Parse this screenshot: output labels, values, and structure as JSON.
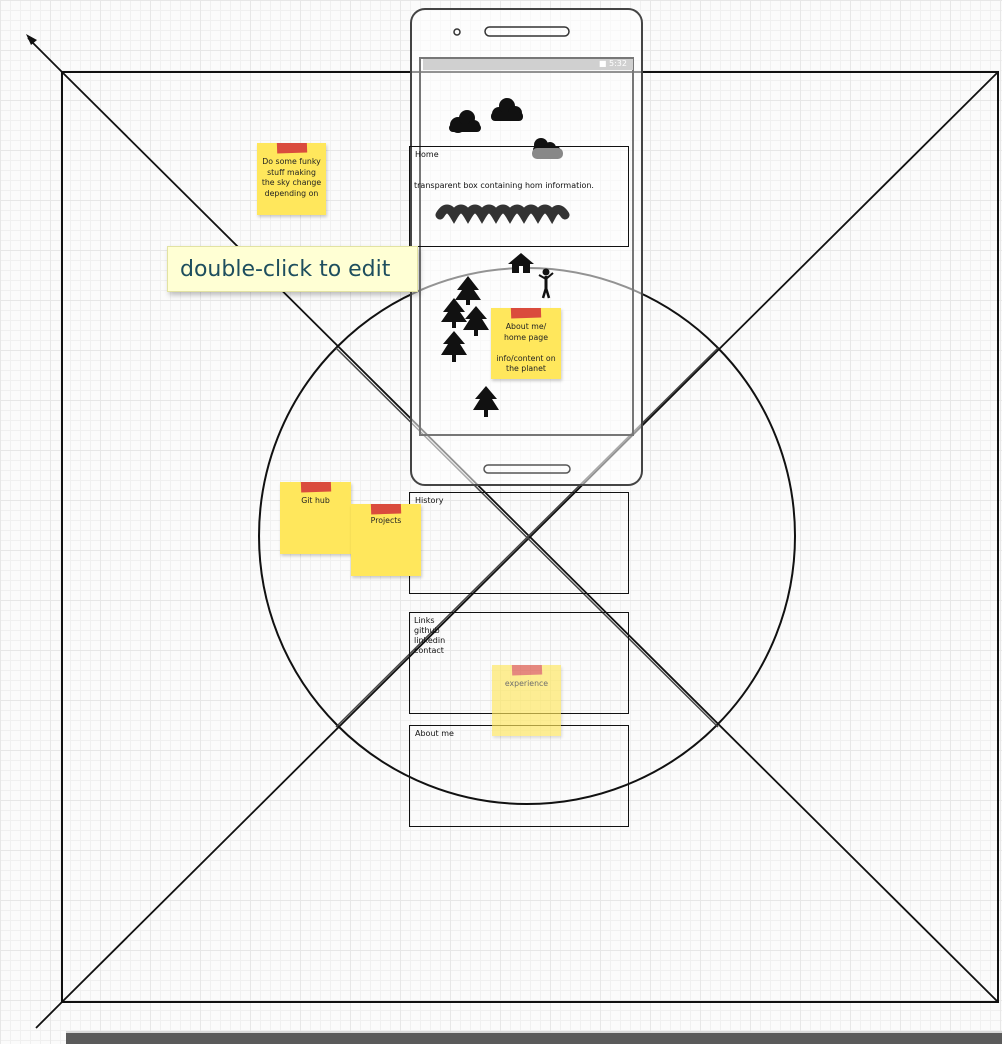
{
  "sticky_notes": {
    "funky": "Do some funky stuff making the sky change depending on",
    "about": "About me/ home page\n\ninfo/content on the planet",
    "github": "Git hub",
    "projects": "Projects",
    "experience": "experience"
  },
  "tooltip": "double-click to edit",
  "phone": {
    "status_text": "■ 5:32",
    "home_title": "Home",
    "home_text": "transparent box containing hom information."
  },
  "panels": {
    "history_title": "History",
    "links_title": "Links",
    "links_items": [
      "github",
      "linkedin",
      "contact"
    ],
    "about_title": "About me"
  },
  "colors": {
    "sticky": "#ffe75c",
    "tape": "#d63a3a",
    "tooltip_bg": "#ffffd4",
    "tooltip_text": "#1e4e5e"
  },
  "icons": [
    "cloud-icon",
    "house-icon",
    "person-icon",
    "tree-icon",
    "scribble-icon",
    "arrow-icon"
  ]
}
